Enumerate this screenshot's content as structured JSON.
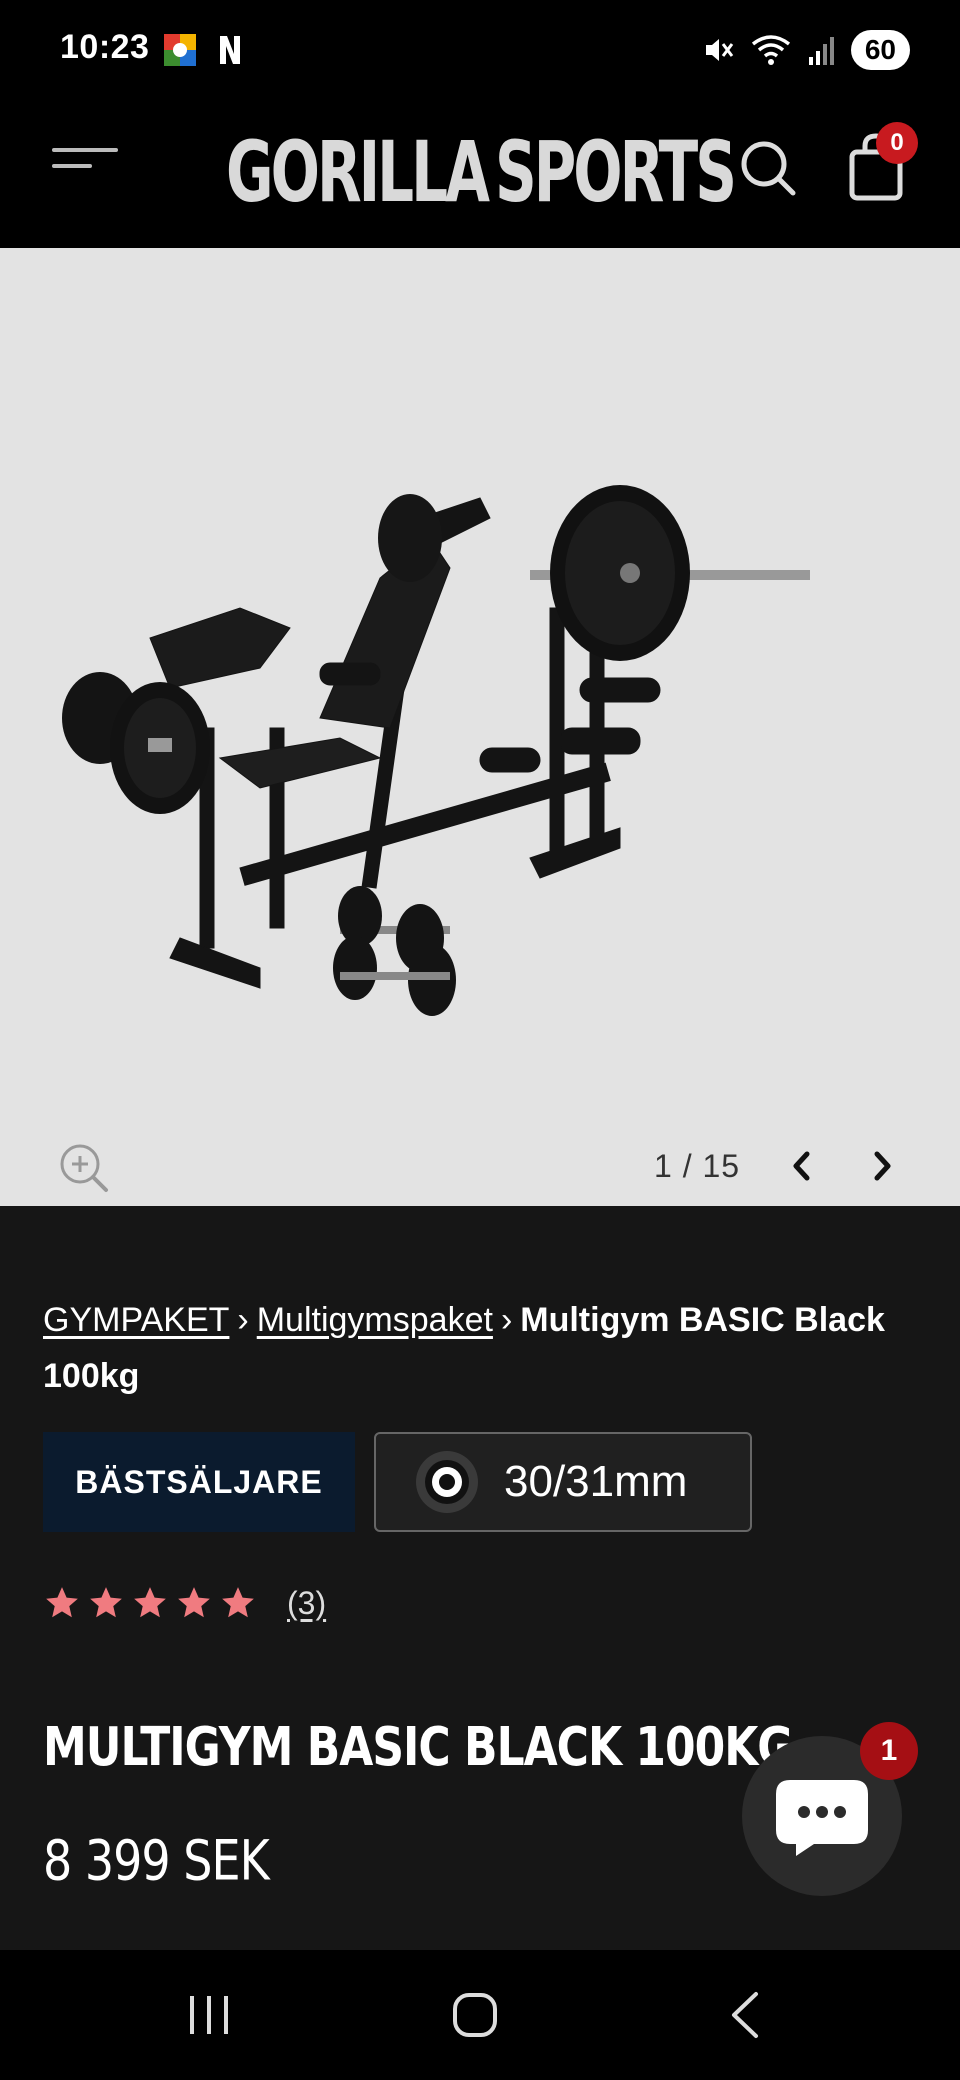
{
  "status_bar": {
    "time": "10:23",
    "battery": "60",
    "icons": [
      "app-notification-icon",
      "netflix-n-icon",
      "mute-icon",
      "wifi-icon",
      "signal-icon"
    ]
  },
  "header": {
    "logo_left": "GORILLA",
    "logo_right": "SPORTS",
    "cart_count": "0",
    "icons": [
      "menu-icon",
      "search-icon",
      "cart-icon"
    ]
  },
  "gallery": {
    "counter": "1 / 15",
    "image_subject": "multigym-bench-with-barbells-and-dumbbells"
  },
  "breadcrumb": {
    "items": [
      "GYMPAKET",
      "Multigymspaket"
    ],
    "current": "Multigym BASIC Black 100kg",
    "separator": "›"
  },
  "badges": {
    "bestseller": "BÄSTSÄLJARE",
    "size": "30/31mm"
  },
  "rating": {
    "stars": 5,
    "count": "(3)"
  },
  "product": {
    "title": "MULTIGYM BASIC BLACK 100KG",
    "price": "8 399 SEK"
  },
  "chat": {
    "badge": "1"
  },
  "colors": {
    "background": "#161616",
    "header": "#000000",
    "gallery": "#e3e3e3",
    "cart_badge": "#c81a1f",
    "bestseller_badge": "#0b1b2e",
    "star": "#f07b80",
    "chat_badge": "#a50f14"
  }
}
